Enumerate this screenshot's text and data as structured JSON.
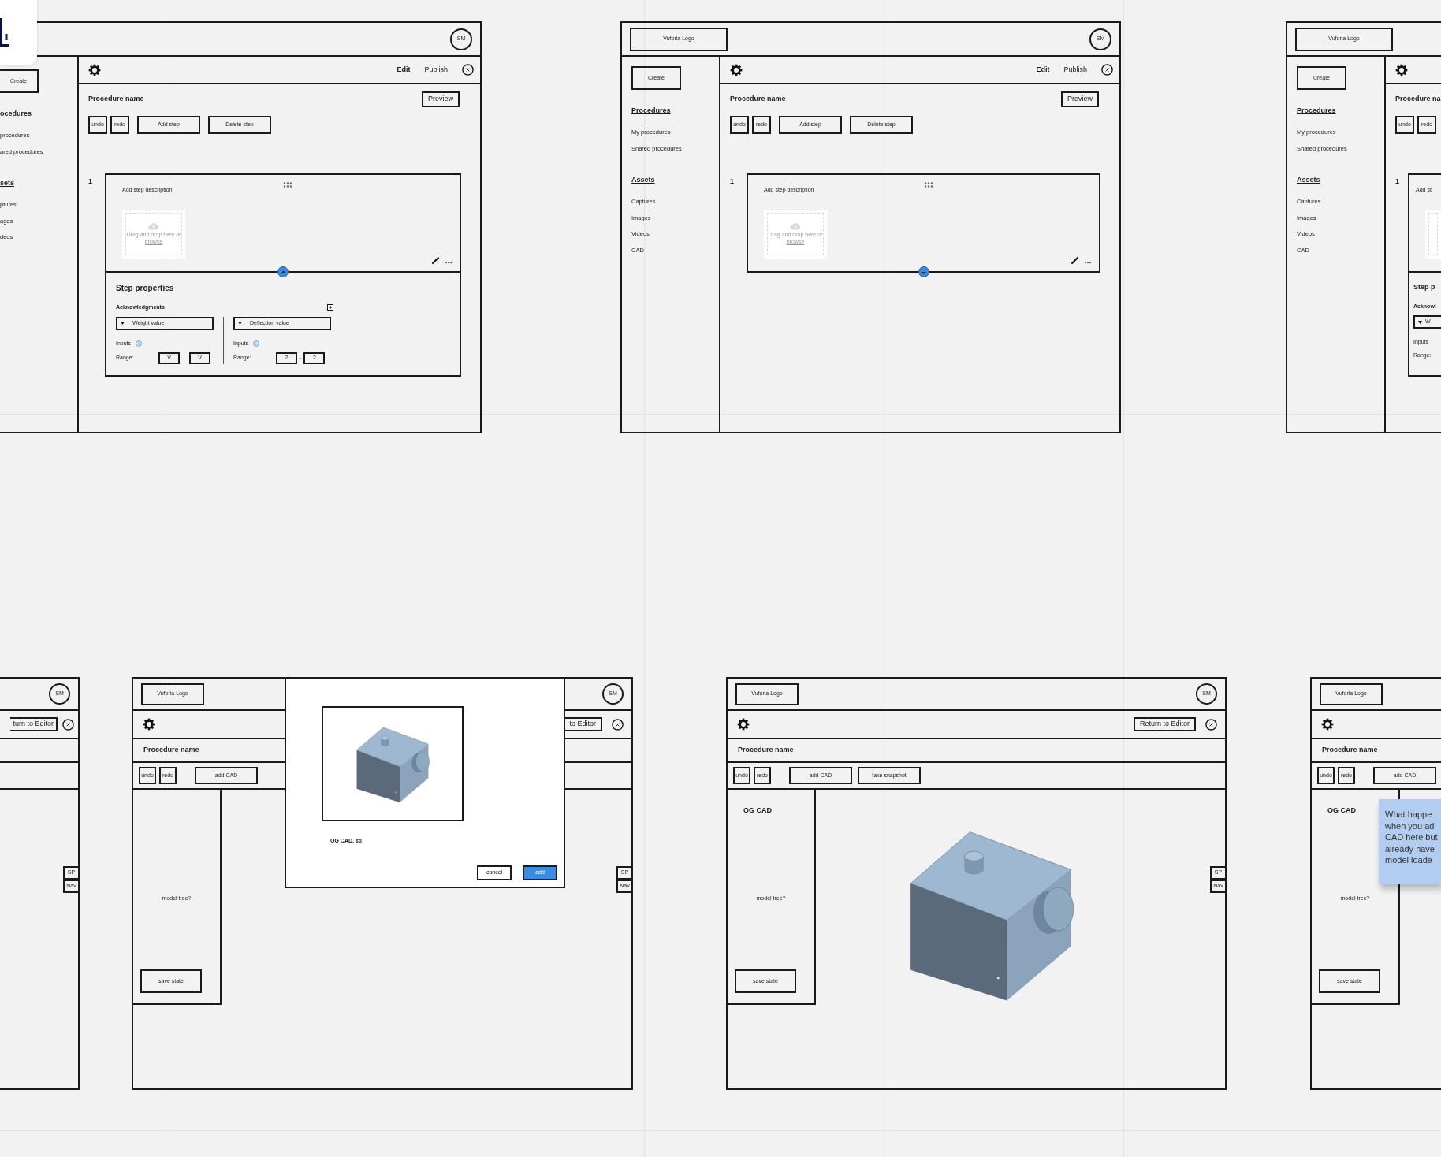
{
  "editor_frames": [
    {
      "avatar": "SM",
      "create": "Create",
      "sections": [
        {
          "title": "ocedures",
          "items": [
            "procedures",
            "ared procedures"
          ]
        },
        {
          "title": "sets",
          "items": [
            "ptures",
            "ages",
            "deos"
          ]
        }
      ],
      "tabs": [
        {
          "label": "Edit",
          "selected": true
        },
        {
          "label": "Publish",
          "selected": false
        }
      ],
      "procedure_name": "Procedure name",
      "preview": "Preview",
      "actions": [
        "undo",
        "redo",
        "Add step",
        "Delete step"
      ],
      "step": {
        "number": "1",
        "description": "Add step description",
        "dropzone": {
          "text": "Drag and drop here or",
          "link": "browse"
        },
        "expanded": true,
        "properties": {
          "title": "Step properties",
          "subtitle": "Acknowledgments",
          "columns": [
            {
              "dropdown": "Weight value",
              "inputs_label": "Inputs",
              "range_label": "Range:",
              "range": [
                "V",
                "V"
              ]
            },
            {
              "dropdown": "Deflection value",
              "inputs_label": "Inputs",
              "range_label": "Range:",
              "range": [
                "2",
                "2"
              ],
              "separator": "-"
            }
          ]
        }
      }
    },
    {
      "logo": "Vuforia Logo",
      "avatar": "SM",
      "create": "Create",
      "sections": [
        {
          "title": "Procedures",
          "items": [
            "My procedures",
            "Shared procedures"
          ]
        },
        {
          "title": "Assets",
          "items": [
            "Captures",
            "Images",
            "Videos",
            "CAD"
          ]
        }
      ],
      "tabs": [
        {
          "label": "Edit",
          "selected": true
        },
        {
          "label": "Publish",
          "selected": false
        }
      ],
      "procedure_name": "Procedure name",
      "preview": "Preview",
      "actions": [
        "undo",
        "redo",
        "Add step",
        "Delete step"
      ],
      "step": {
        "number": "1",
        "description": "Add step description",
        "dropzone": {
          "text": "Drag and drop here or",
          "link": "browse"
        },
        "expanded": false
      }
    },
    {
      "logo": "Vuforia Logo",
      "create": "Create",
      "sections": [
        {
          "title": "Procedures",
          "items": [
            "My procedures",
            "Shared procedures"
          ]
        },
        {
          "title": "Assets",
          "items": [
            "Captures",
            "Images",
            "Videos",
            "CAD"
          ]
        }
      ],
      "procedure_name": "Procedure na",
      "actions": [
        "undo",
        "redo"
      ],
      "step": {
        "number": "1",
        "description": "Add st",
        "expanded": true,
        "properties": {
          "title": "Step p",
          "subtitle": "Acknowl",
          "columns": [
            {
              "dropdown": "W",
              "inputs_label": "Inputs",
              "range_label": "Range:"
            }
          ]
        }
      }
    }
  ],
  "cad_frames": [
    {
      "avatar": "SM",
      "return_button": "turn to Editor",
      "side_tabs": [
        "SP",
        "Nav"
      ]
    },
    {
      "logo": "Vuforia Logo",
      "avatar": "SM",
      "return_button": "to Editor",
      "procedure_name": "Procedure name",
      "actions": [
        "undo",
        "redo",
        "add CAD"
      ],
      "panel": {
        "model_tree": "model tree?",
        "save": "save state"
      },
      "side_tabs": [
        "SP",
        "Nav"
      ]
    },
    {
      "logo": "Vuforia Logo",
      "avatar": "SM",
      "return_button": "Return to Editor",
      "procedure_name": "Procedure name",
      "actions": [
        "undo",
        "redo",
        "add CAD",
        "take snapshot"
      ],
      "panel": {
        "title": "OG CAD",
        "model_tree": "model tree?",
        "save": "save state"
      },
      "model": {
        "kind": "picture"
      },
      "side_tabs": [
        "SP",
        "Nav"
      ]
    },
    {
      "logo": "Vuforia Logo",
      "procedure_name": "Procedure name",
      "actions": [
        "undo",
        "redo",
        "add CAD"
      ],
      "panel": {
        "title": "OG CAD",
        "model_tree": "model tree?",
        "save": "save state"
      }
    }
  ],
  "modal": {
    "preview": {
      "kind": "picture"
    },
    "file_name": "OG CAD. stl",
    "buttons": [
      {
        "label": "cancel",
        "primary": false
      },
      {
        "label": "add",
        "primary": true
      }
    ]
  },
  "sticky_note": {
    "lines": [
      "What happe",
      "when you ad",
      "CAD here but",
      "already have",
      "model loade"
    ]
  }
}
